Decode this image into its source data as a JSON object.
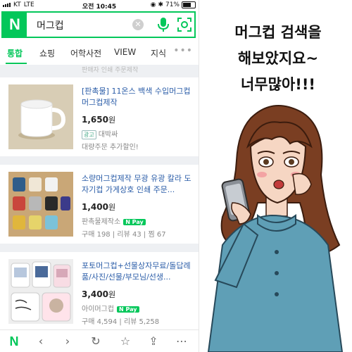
{
  "status_bar": {
    "carrier": "KT",
    "network": "LTE",
    "time": "오전 10:45",
    "battery": "71%"
  },
  "search": {
    "query": "머그컵",
    "clear_icon": "x-icon",
    "mic_icon": "mic-icon",
    "lens_icon": "lens-icon"
  },
  "tabs": [
    {
      "label": "통합",
      "active": true
    },
    {
      "label": "쇼핑"
    },
    {
      "label": "어학사전"
    },
    {
      "label": "VIEW"
    },
    {
      "label": "지식"
    }
  ],
  "faded_text": "판매자 인쇄 주문제작",
  "products": [
    {
      "title": "[판촉물] 11온스 백색 수입머그컵 머그컵제작",
      "price": "1,650",
      "currency": "원",
      "ad_label": "광고",
      "seller": "대박싸",
      "extra": "대량주문 추가할인!"
    },
    {
      "title": "소량머그컵제작 무광 유광 칼라 도자기컵 가게상호 인쇄 주문...",
      "price": "1,400",
      "currency": "원",
      "seller": "판촉물제작소",
      "npay": "N Pay",
      "stats": {
        "purchase": "구매 198",
        "review": "리뷰 43",
        "zzim": "찜 67"
      }
    },
    {
      "title": "포토머그컵+선물상자무료/돌답례품/사진/선물/부모님/선생...",
      "price": "3,400",
      "currency": "원",
      "seller": "아이머그컵",
      "npay": "N Pay",
      "stats": {
        "purchase": "구매 4,594",
        "review": "리뷰 5,258"
      }
    }
  ],
  "bottom_bar": [
    "naver-home-icon",
    "back-icon",
    "forward-icon",
    "refresh-icon",
    "bookmark-icon",
    "share-icon",
    "more-icon"
  ],
  "bubble": {
    "line1": "머그컵 검색을",
    "line2": "해보았지요~",
    "line3": "너무많아!!!"
  },
  "colors": {
    "naver_green": "#03c75a",
    "title_blue": "#2b5da8",
    "dress_teal": "#5f9fb6",
    "hair_brown": "#7a3e22"
  }
}
